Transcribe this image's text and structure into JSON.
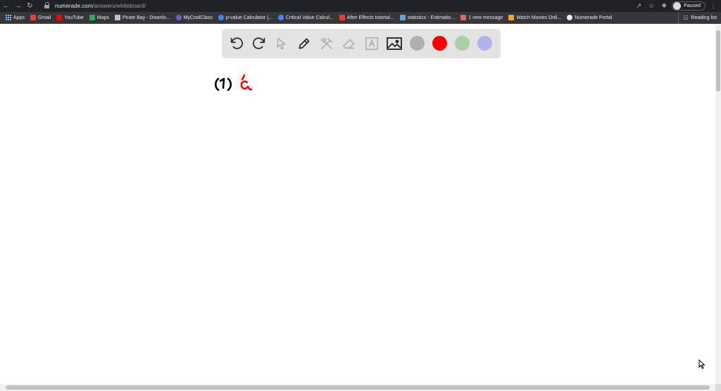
{
  "browser": {
    "url_host": "numerade.com",
    "url_path": "/answers/whiteboard/",
    "profile_label": "Paused",
    "reading_list_label": "Reading list"
  },
  "bookmarks": [
    {
      "label": "Apps",
      "icon": "apps-grid-icon",
      "color": "#8ab4f8"
    },
    {
      "label": "Gmail",
      "icon": "gmail-icon",
      "color": "#ea4335"
    },
    {
      "label": "YouTube",
      "icon": "youtube-icon",
      "color": "#ff0000"
    },
    {
      "label": "Maps",
      "icon": "maps-icon",
      "color": "#34a853"
    },
    {
      "label": "Pirate Bay - Downlo...",
      "icon": "document-icon",
      "color": "#bdc1c6"
    },
    {
      "label": "MyCoolClass",
      "icon": "mycoolclass-icon",
      "color": "#6f5bd6"
    },
    {
      "label": "p-value Calculator |...",
      "icon": "calculator-icon",
      "color": "#4285f4"
    },
    {
      "label": "Critical Value Calcul...",
      "icon": "calculator-icon",
      "color": "#4285f4"
    },
    {
      "label": "After Effects tutorial...",
      "icon": "adobe-icon",
      "color": "#ff3333"
    },
    {
      "label": "statistics - Estimatio...",
      "icon": "stackexchange-icon",
      "color": "#6aa0d8"
    },
    {
      "label": "1 new message",
      "icon": "message-icon",
      "color": "#e06666"
    },
    {
      "label": "Watch Movies Onli...",
      "icon": "movie-icon",
      "color": "#f5a623"
    },
    {
      "label": "Numerade Portal",
      "icon": "globe-icon",
      "color": "#e8eaed"
    }
  ],
  "toolbar": {
    "tools": [
      {
        "name": "undo-icon",
        "enabled": true
      },
      {
        "name": "redo-icon",
        "enabled": true
      },
      {
        "name": "pointer-icon",
        "enabled": false
      },
      {
        "name": "pen-icon",
        "enabled": true
      },
      {
        "name": "tools-icon",
        "enabled": false
      },
      {
        "name": "eraser-icon",
        "enabled": false
      },
      {
        "name": "text-box-icon",
        "enabled": false
      },
      {
        "name": "image-icon",
        "enabled": true
      }
    ],
    "colors": [
      "#b0b0b0",
      "#ff0000",
      "#a9cfa4",
      "#b3b3ea"
    ]
  },
  "canvas": {
    "ink_black": "#000000",
    "ink_red": "#ff0000"
  }
}
